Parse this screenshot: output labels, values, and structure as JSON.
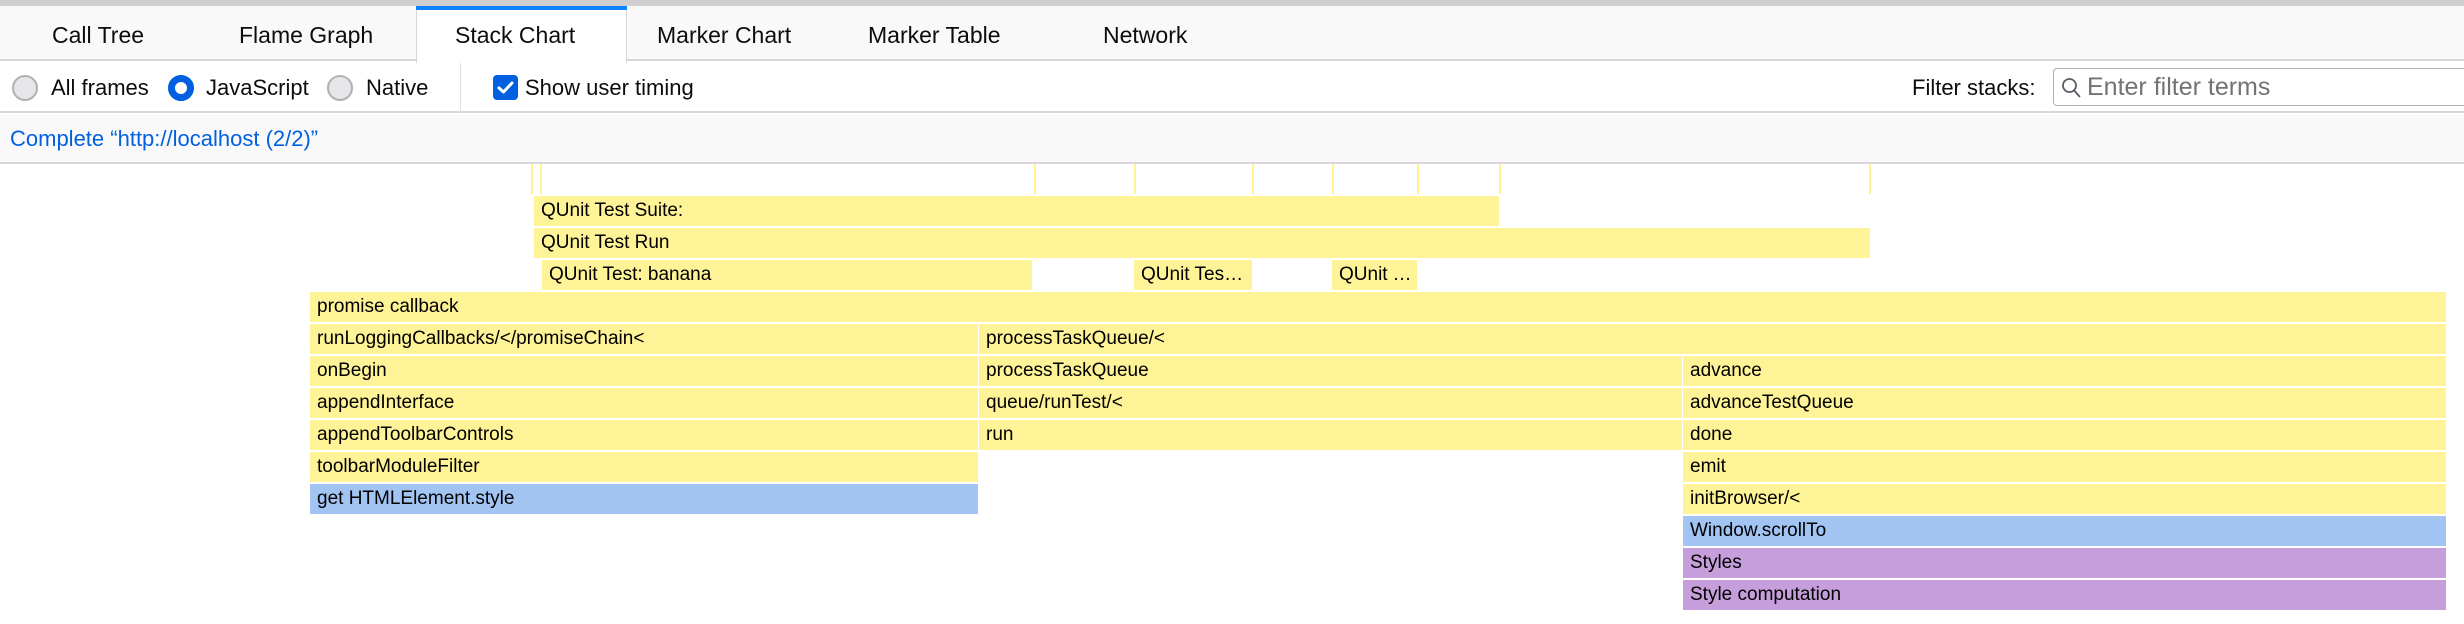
{
  "tabs": [
    {
      "label": "Call Tree",
      "active": false
    },
    {
      "label": "Flame Graph",
      "active": false
    },
    {
      "label": "Stack Chart",
      "active": true
    },
    {
      "label": "Marker Chart",
      "active": false
    },
    {
      "label": "Marker Table",
      "active": false
    },
    {
      "label": "Network",
      "active": false
    }
  ],
  "toolbar": {
    "implementation_options": [
      {
        "label": "All frames",
        "checked": false
      },
      {
        "label": "JavaScript",
        "checked": true
      },
      {
        "label": "Native",
        "checked": false
      }
    ],
    "show_user_timing": {
      "label": "Show user timing",
      "checked": true
    },
    "filter_label": "Filter stacks:",
    "filter_value": "",
    "filter_placeholder": "Enter filter terms",
    "search_icon": "search-icon"
  },
  "breadcrumb": {
    "label": "Complete “http://localhost (2/2)”"
  },
  "colors": {
    "js_yellow": "#fef397",
    "dom_blue": "#a1c4f2",
    "layout_purple": "#c59edb",
    "accent_blue": "#0060df",
    "tab_highlight": "#0a84ff"
  },
  "chart_data": {
    "type": "stack-chart",
    "time_unit": "percent of visible range",
    "visible_range": [
      0,
      100
    ],
    "user_timing_markers": [
      21.59,
      21.96,
      42.0,
      46.06,
      50.85,
      54.1,
      57.55,
      60.88,
      75.89
    ],
    "user_timing_frames": [
      {
        "label": "QUnit Test Suite:",
        "depth": -3,
        "start": 21.67,
        "end": 60.84,
        "category": "js_yellow"
      },
      {
        "label": "QUnit Test Run",
        "depth": -2,
        "start": 21.67,
        "end": 75.89,
        "category": "js_yellow"
      },
      {
        "label": "QUnit Test: banana",
        "depth": -1,
        "start": 22.0,
        "end": 41.88,
        "category": "js_yellow"
      },
      {
        "label": "QUnit Test…",
        "depth": -1,
        "start": 46.02,
        "end": 50.81,
        "category": "js_yellow"
      },
      {
        "label": "QUnit Test…",
        "depth": -1,
        "start": 54.06,
        "end": 57.51,
        "category": "js_yellow"
      }
    ],
    "frames": [
      {
        "label": "promise callback",
        "depth": 0,
        "start": 12.58,
        "end": 99.27,
        "category": "js_yellow"
      },
      {
        "label": "runLoggingCallbacks/</promiseChain<",
        "depth": 1,
        "start": 12.58,
        "end": 39.69,
        "category": "js_yellow"
      },
      {
        "label": "onBegin",
        "depth": 2,
        "start": 12.58,
        "end": 39.69,
        "category": "js_yellow"
      },
      {
        "label": "appendInterface",
        "depth": 3,
        "start": 12.58,
        "end": 39.69,
        "category": "js_yellow"
      },
      {
        "label": "appendToolbarControls",
        "depth": 4,
        "start": 12.58,
        "end": 39.69,
        "category": "js_yellow"
      },
      {
        "label": "toolbarModuleFilter",
        "depth": 5,
        "start": 12.58,
        "end": 39.69,
        "category": "js_yellow"
      },
      {
        "label": "get HTMLElement.style",
        "depth": 6,
        "start": 12.58,
        "end": 39.69,
        "category": "dom_blue"
      },
      {
        "label": "processTaskQueue/<",
        "depth": 1,
        "start": 39.73,
        "end": 99.27,
        "category": "js_yellow"
      },
      {
        "label": "processTaskQueue",
        "depth": 2,
        "start": 39.73,
        "end": 68.26,
        "category": "js_yellow"
      },
      {
        "label": "queue/runTest/<",
        "depth": 3,
        "start": 39.73,
        "end": 68.26,
        "category": "js_yellow"
      },
      {
        "label": "run",
        "depth": 4,
        "start": 39.73,
        "end": 68.26,
        "category": "js_yellow"
      },
      {
        "label": "advance",
        "depth": 2,
        "start": 68.3,
        "end": 99.27,
        "category": "js_yellow"
      },
      {
        "label": "advanceTestQueue",
        "depth": 3,
        "start": 68.3,
        "end": 99.27,
        "category": "js_yellow"
      },
      {
        "label": "done",
        "depth": 4,
        "start": 68.3,
        "end": 99.27,
        "category": "js_yellow"
      },
      {
        "label": "emit",
        "depth": 5,
        "start": 68.3,
        "end": 99.27,
        "category": "js_yellow"
      },
      {
        "label": "initBrowser/<",
        "depth": 6,
        "start": 68.3,
        "end": 99.27,
        "category": "js_yellow"
      },
      {
        "label": "Window.scrollTo",
        "depth": 7,
        "start": 68.3,
        "end": 99.27,
        "category": "dom_blue"
      },
      {
        "label": "Styles",
        "depth": 8,
        "start": 68.3,
        "end": 99.27,
        "category": "layout_purple"
      },
      {
        "label": "Style computation",
        "depth": 9,
        "start": 68.3,
        "end": 99.27,
        "category": "layout_purple"
      }
    ]
  }
}
